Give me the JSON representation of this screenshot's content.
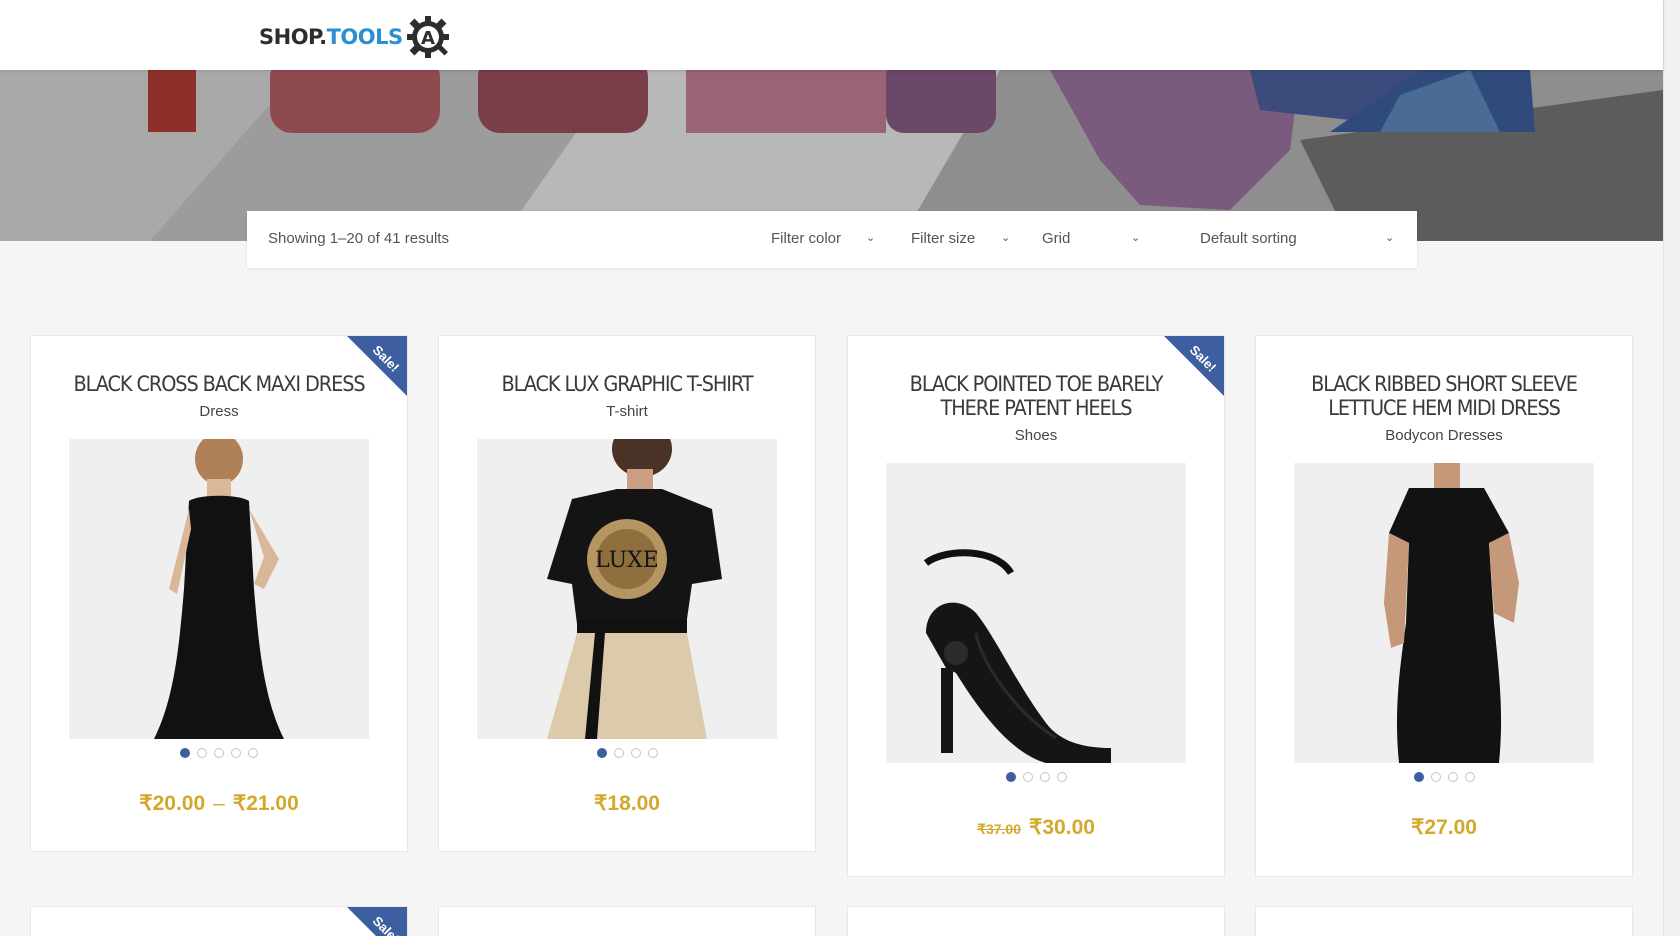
{
  "header": {
    "logo_shop": "SHOP.",
    "logo_tools": "TOOLS",
    "logo_alt": "SHOP.TOOLSQA"
  },
  "toolbar": {
    "result_count": "Showing 1–20 of 41 results",
    "filter_color": "Filter color",
    "filter_size": "Filter size",
    "view": "Grid",
    "sorting": "Default sorting"
  },
  "colors": {
    "accent": "#3e5f9f",
    "price": "#d3a82b",
    "logo_blue": "#2b8fd1"
  },
  "products": [
    {
      "title": "BLACK CROSS BACK MAXI DRESS",
      "category": "Dress",
      "sale": true,
      "sale_label": "Sale!",
      "price": "₹20.00",
      "price_max": "₹21.00",
      "price_sep": "–",
      "dots": 5,
      "image": "black-maxi-dress"
    },
    {
      "title": "BLACK LUX GRAPHIC T-SHIRT",
      "category": "T-shirt",
      "sale": false,
      "price": "₹18.00",
      "dots": 4,
      "image": "black-graphic-tshirt"
    },
    {
      "title": "BLACK POINTED TOE BARELY THERE PATENT HEELS",
      "category": "Shoes",
      "sale": true,
      "sale_label": "Sale!",
      "old_price": "₹37.00",
      "price": "₹30.00",
      "dots": 4,
      "image": "black-heels"
    },
    {
      "title": "BLACK RIBBED SHORT SLEEVE LETTUCE HEM MIDI DRESS",
      "category": "Bodycon Dresses",
      "sale": false,
      "price": "₹27.00",
      "dots": 4,
      "image": "black-midi-dress"
    }
  ],
  "next_row": {
    "sale_label": "Sale!"
  }
}
